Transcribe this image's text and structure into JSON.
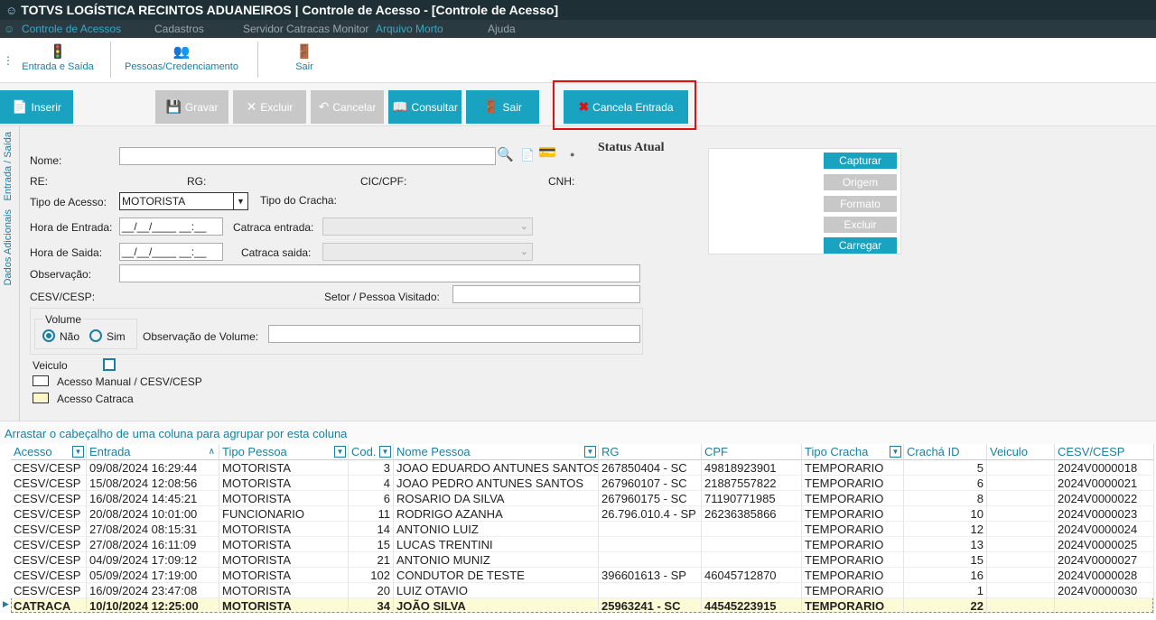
{
  "window": {
    "title": "TOTVS LOGÍSTICA RECINTOS ADUANEIROS | Controle de Acesso - [Controle de Acesso]"
  },
  "menu": [
    {
      "label": "Controle de Acessos"
    },
    {
      "label": "Cadastros"
    },
    {
      "label": "Servidor Catracas Monitor"
    },
    {
      "label": "Arquivo Morto"
    },
    {
      "label": "Ajuda"
    }
  ],
  "toolbar1": {
    "entrada_saida": "Entrada e Saída",
    "pessoas": "Pessoas/Credenciamento",
    "sair": "Sair"
  },
  "toolbar2": {
    "inserir": "Inserir",
    "gravar": "Gravar",
    "excluir": "Excluir",
    "cancelar": "Cancelar",
    "consultar": "Consultar",
    "sair": "Sair",
    "cancela_entrada": "Cancela Entrada"
  },
  "sidetabs": {
    "entrada_saida": "Entrada / Saída",
    "dados_adicionais": "Dados Adicionais"
  },
  "form": {
    "nome_label": "Nome:",
    "nome_value": "",
    "re_label": "RE:",
    "rg_label": "RG:",
    "cic_label": "CIC/CPF:",
    "cnh_label": "CNH:",
    "tipo_acesso_label": "Tipo de Acesso:",
    "tipo_acesso_value": "MOTORISTA",
    "tipo_cracha_label": "Tipo do Cracha:",
    "hora_entrada_label": "Hora de Entrada:",
    "hora_entrada_value": "__/__/____ __:__",
    "catraca_entrada_label": "Catraca entrada:",
    "hora_saida_label": "Hora de Saida:",
    "hora_saida_value": "__/__/____ __:__",
    "catraca_saida_label": "Catraca saida:",
    "observacao_label": "Observação:",
    "cesv_label": "CESV/CESP:",
    "setor_label": "Setor / Pessoa Visitado:",
    "volume_label": "Volume",
    "nao_label": "Não",
    "sim_label": "Sim",
    "obs_volume_label": "Observação de Volume:",
    "veiculo_label": "Veiculo",
    "legend_manual": "Acesso Manual / CESV/CESP",
    "legend_catraca": "Acesso Catraca",
    "status_atual": "Status Atual"
  },
  "photo_panel": {
    "capturar": "Capturar",
    "origem": "Origem",
    "formato": "Formato",
    "excluir": "Excluir",
    "carregar": "Carregar"
  },
  "grid": {
    "hint": "Arrastar o cabeçalho de uma coluna para agrupar por esta coluna",
    "columns": [
      "Acesso",
      "Entrada",
      "Tipo Pessoa",
      "Cod.",
      "Nome Pessoa",
      "RG",
      "CPF",
      "Tipo Cracha",
      "Crachá ID",
      "Veiculo",
      "CESV/CESP"
    ],
    "rows": [
      [
        "CESV/CESP",
        "09/08/2024 16:29:44",
        "MOTORISTA",
        "3",
        "JOAO EDUARDO ANTUNES SANTOS",
        "267850404 - SC",
        "49818923901",
        "TEMPORARIO",
        "5",
        "",
        "2024V0000018"
      ],
      [
        "CESV/CESP",
        "15/08/2024 12:08:56",
        "MOTORISTA",
        "4",
        "JOAO PEDRO ANTUNES SANTOS",
        "267960107 - SC",
        "21887557822",
        "TEMPORARIO",
        "6",
        "",
        "2024V0000021"
      ],
      [
        "CESV/CESP",
        "16/08/2024 14:45:21",
        "MOTORISTA",
        "6",
        "ROSARIO DA SILVA",
        "267960175 - SC",
        "71190771985",
        "TEMPORARIO",
        "8",
        "",
        "2024V0000022"
      ],
      [
        "CESV/CESP",
        "20/08/2024 10:01:00",
        "FUNCIONARIO",
        "11",
        "RODRIGO AZANHA",
        "26.796.010.4 - SP",
        "26236385866",
        "TEMPORARIO",
        "10",
        "",
        "2024V0000023"
      ],
      [
        "CESV/CESP",
        "27/08/2024 08:15:31",
        "MOTORISTA",
        "14",
        "ANTONIO LUIZ",
        "",
        "",
        "TEMPORARIO",
        "12",
        "",
        "2024V0000024"
      ],
      [
        "CESV/CESP",
        "27/08/2024 16:11:09",
        "MOTORISTA",
        "15",
        "LUCAS TRENTINI",
        "",
        "",
        "TEMPORARIO",
        "13",
        "",
        "2024V0000025"
      ],
      [
        "CESV/CESP",
        "04/09/2024 17:09:12",
        "MOTORISTA",
        "21",
        "ANTONIO MUNIZ",
        "",
        "",
        "TEMPORARIO",
        "15",
        "",
        "2024V0000027"
      ],
      [
        "CESV/CESP",
        "05/09/2024 17:19:00",
        "MOTORISTA",
        "102",
        "CONDUTOR DE TESTE",
        "396601613 - SP",
        "46045712870",
        "TEMPORARIO",
        "16",
        "",
        "2024V0000028"
      ],
      [
        "CESV/CESP",
        "16/09/2024 23:47:08",
        "MOTORISTA",
        "20",
        "LUIZ OTAVIO",
        "",
        "",
        "TEMPORARIO",
        "1",
        "",
        "2024V0000030"
      ],
      [
        "CATRACA",
        "10/10/2024 12:25:00",
        "MOTORISTA",
        "34",
        "JOÃO SILVA",
        "25963241 - SC",
        "44545223915",
        "TEMPORARIO",
        "22",
        "",
        ""
      ]
    ]
  },
  "colors": {
    "accent": "#1aa2c1",
    "titlebar": "#1f2f36",
    "highlight": "#e01010"
  }
}
